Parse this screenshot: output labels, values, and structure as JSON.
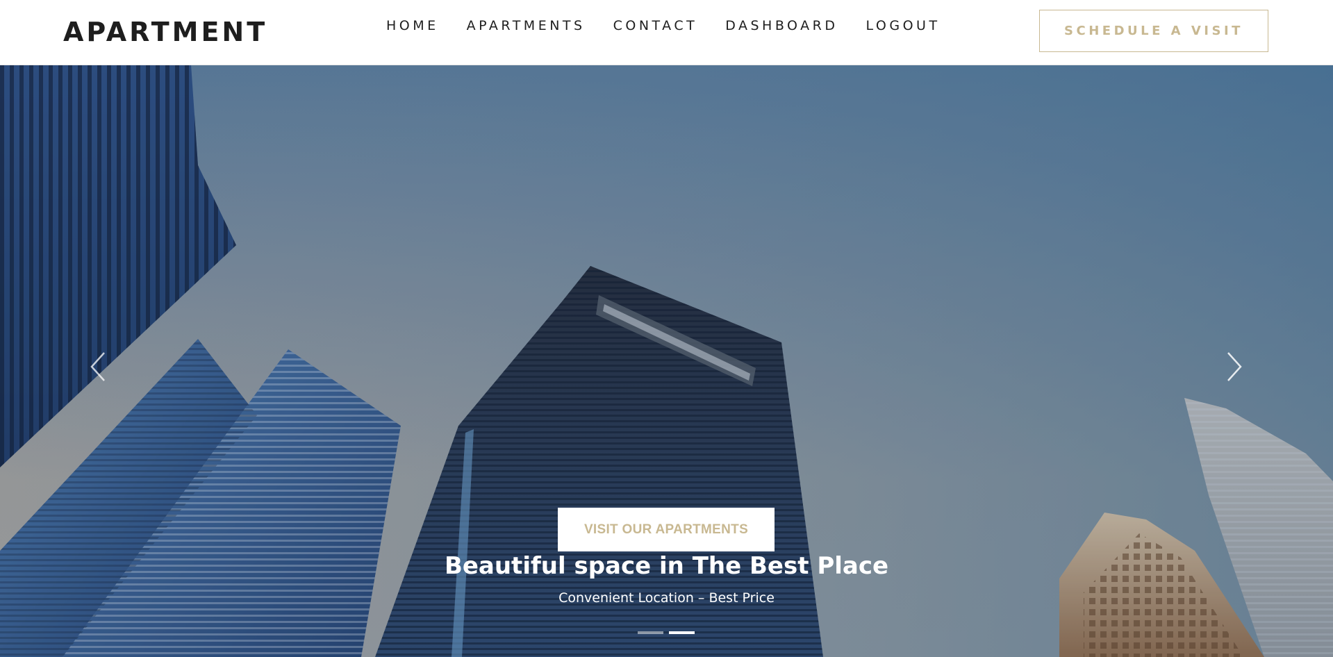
{
  "brand": {
    "name": "APARTMENT"
  },
  "nav": {
    "items": [
      {
        "label": "HOME"
      },
      {
        "label": "APARTMENTS"
      },
      {
        "label": "CONTACT"
      },
      {
        "label": "DASHBOARD"
      },
      {
        "label": "LOGOUT"
      }
    ]
  },
  "header": {
    "cta_label": "SCHEDULE A VISIT"
  },
  "hero": {
    "button_label": "VISIT OUR APARTMENTS",
    "title": "Beautiful space in The Best Place",
    "subtitle": "Convenient Location – Best Price",
    "prev_icon": "chevron-left-icon",
    "next_icon": "chevron-right-icon",
    "slides_total": 2,
    "active_slide": 2
  },
  "colors": {
    "accent": "#c8b891",
    "text_dark": "#1e1e1e",
    "header_bg": "#ffffff",
    "hero_text": "#ffffff"
  }
}
